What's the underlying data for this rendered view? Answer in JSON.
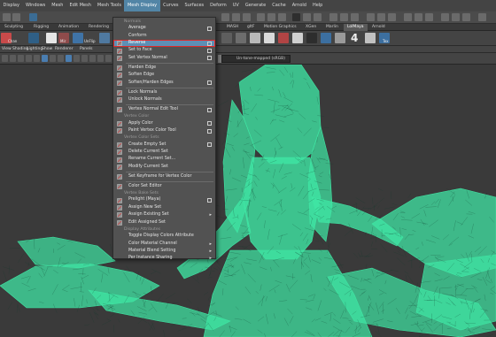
{
  "menubar": {
    "items": [
      "Display",
      "Windows",
      "Mesh",
      "Edit Mesh",
      "Mesh Tools",
      "Mesh Display",
      "Curves",
      "Surfaces",
      "Deform",
      "UV",
      "Generate",
      "Cache",
      "Arnold",
      "Help"
    ],
    "active_index": 5
  },
  "shelf_tabs": [
    "Sculpting",
    "Rigging",
    "Animation",
    "Rendering",
    "MASH",
    "gltF",
    "Motion Graphics",
    "XGen",
    "Marlin",
    "LolMaya",
    "Arnold"
  ],
  "shelf_tabs_active_index": 9,
  "shelf_labels": {
    "chan": "Chan",
    "mirror": "Mir",
    "unflip": "UnFlip",
    "tex": "Tex",
    "big_number": "4"
  },
  "panel_menu": [
    "View",
    "Shading",
    "Lighting",
    "Show",
    "Renderer",
    "Panels"
  ],
  "color_management": "Un-tone-mapped (sRGB)",
  "dropdown": {
    "title": "Normals",
    "rows": [
      {
        "type": "section",
        "label": "Normals"
      },
      {
        "type": "item",
        "label": "Average",
        "option": true
      },
      {
        "type": "item",
        "label": "Conform"
      },
      {
        "type": "item",
        "label": "Reverse",
        "option": true,
        "highlighted": true,
        "icon": "reverse-normal-icon"
      },
      {
        "type": "item",
        "label": "Set to Face",
        "option": true,
        "icon": "set-face-normal-icon"
      },
      {
        "type": "item",
        "label": "Set Vertex Normal",
        "option": true,
        "icon": "vertex-normal-icon"
      },
      {
        "type": "sep"
      },
      {
        "type": "item",
        "label": "Harden Edge",
        "icon": "harden-edge-icon"
      },
      {
        "type": "item",
        "label": "Soften Edge",
        "icon": "soften-edge-icon"
      },
      {
        "type": "item",
        "label": "Soften/Harden Edges",
        "option": true,
        "icon": "soften-harden-icon"
      },
      {
        "type": "sep"
      },
      {
        "type": "item",
        "label": "Lock Normals",
        "icon": "lock-normals-icon"
      },
      {
        "type": "item",
        "label": "Unlock Normals",
        "icon": "unlock-normals-icon"
      },
      {
        "type": "sep"
      },
      {
        "type": "item",
        "label": "Vertex Normal Edit Tool",
        "option": true,
        "icon": "normal-edit-tool-icon"
      },
      {
        "type": "section",
        "label": "Vertex Color"
      },
      {
        "type": "item",
        "label": "Apply Color",
        "option": true,
        "icon": "apply-color-icon"
      },
      {
        "type": "item",
        "label": "Paint Vertex Color Tool",
        "option": true,
        "icon": "paint-vertex-icon"
      },
      {
        "type": "section",
        "label": "Vertex Color Sets"
      },
      {
        "type": "item",
        "label": "Create Empty Set",
        "option": true,
        "icon": "create-set-icon"
      },
      {
        "type": "item",
        "label": "Delete Current Set",
        "icon": "delete-set-icon"
      },
      {
        "type": "item",
        "label": "Rename Current Set...",
        "icon": "rename-set-icon"
      },
      {
        "type": "item",
        "label": "Modify Current Set",
        "icon": "modify-set-icon"
      },
      {
        "type": "sep"
      },
      {
        "type": "item",
        "label": "Set Keyframe for Vertex Color",
        "icon": "keyframe-color-icon"
      },
      {
        "type": "sep"
      },
      {
        "type": "item",
        "label": "Color Set Editor",
        "icon": "color-set-editor-icon"
      },
      {
        "type": "section",
        "label": "Vertex Bake Sets"
      },
      {
        "type": "item",
        "label": "Prelight (Maya)",
        "option": true,
        "icon": "prelight-icon"
      },
      {
        "type": "item",
        "label": "Assign New Set",
        "icon": "assign-new-set-icon"
      },
      {
        "type": "item",
        "label": "Assign Existing Set",
        "submenu": true,
        "icon": "assign-existing-set-icon"
      },
      {
        "type": "item",
        "label": "Edit Assigned Set",
        "icon": "edit-assigned-set-icon"
      },
      {
        "type": "section",
        "label": "Display Attributes"
      },
      {
        "type": "item",
        "label": "Toggle Display Colors Attribute"
      },
      {
        "type": "item",
        "label": "Color Material Channel",
        "submenu": true
      },
      {
        "type": "item",
        "label": "Material Blend Setting",
        "submenu": true
      },
      {
        "type": "item",
        "label": "Per Instance Sharing",
        "submenu": true
      }
    ]
  },
  "colors": {
    "wireframe": "#3fe6a4",
    "highlight": "#5e8fb5",
    "highlight_outline": "#e02a2a"
  }
}
